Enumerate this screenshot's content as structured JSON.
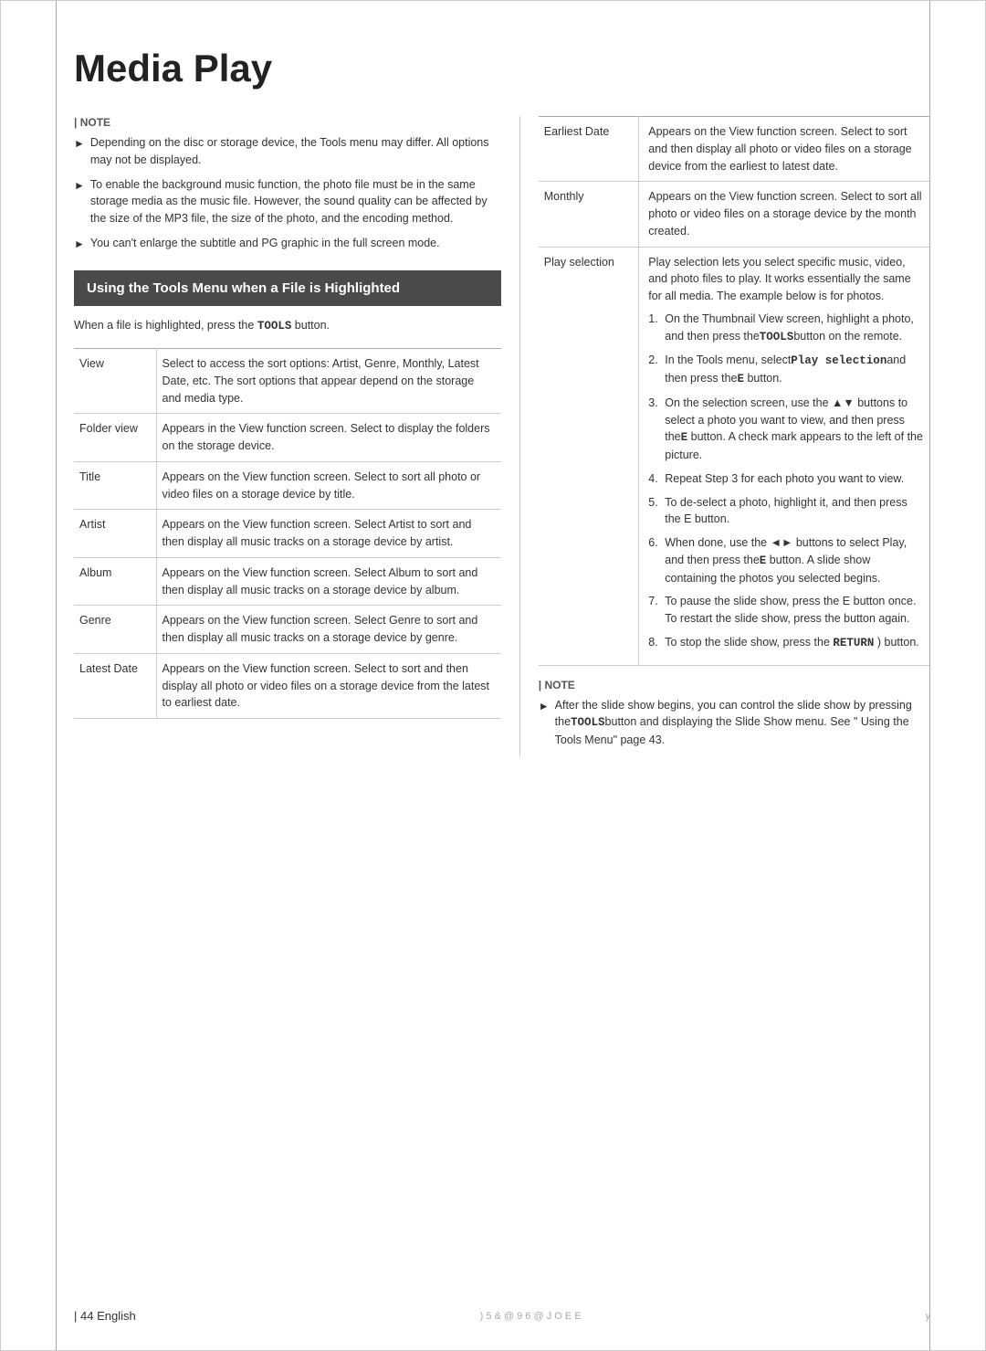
{
  "page": {
    "title": "Media Play",
    "footer": {
      "page_number": "44 English",
      "code": ") 5 &   @ 9 6 @   J O E E",
      "side_char": "y"
    }
  },
  "note_left": {
    "label": "| NOTE",
    "items": [
      "Depending on the disc or storage device, the Tools menu may differ. All options may not be displayed.",
      "To enable the background music function, the photo file must be in the same storage media as the music file. However, the sound quality can be affected by the size of the MP3 file, the size of the photo, and the encoding method.",
      "You can't enlarge the subtitle and PG graphic in the full screen mode."
    ]
  },
  "section_header": {
    "title": "Using the Tools Menu when a File is Highlighted"
  },
  "intro": {
    "text_before": "When a file is highlighted, press the ",
    "keyword": "TOOLS",
    "text_after": " button."
  },
  "menu_table": {
    "rows": [
      {
        "label": "View",
        "description": "Select to access the sort options: Artist, Genre, Monthly, Latest Date, etc. The sort options that appear depend on the storage and media type."
      },
      {
        "label": "Folder view",
        "description": "Appears in the View function screen. Select to display the folders on the storage device."
      },
      {
        "label": "Title",
        "description": "Appears on the View function screen. Select to sort all photo or video files on a storage device by title."
      },
      {
        "label": "Artist",
        "description": "Appears on the View function screen. Select Artist to sort and then display all music tracks on a storage device by artist."
      },
      {
        "label": "Album",
        "description": "Appears on the View function screen. Select Album to sort and then display all music tracks on a storage device by album."
      },
      {
        "label": "Genre",
        "description": "Appears on the View function screen. Select Genre to sort and then display all music tracks on a storage device by genre."
      },
      {
        "label": "Latest Date",
        "description": "Appears on the View function screen. Select to sort and then display all photo or video files on a storage device from the latest to earliest date."
      }
    ]
  },
  "right_col": {
    "note_label": "",
    "earliest_date_label": "Earliest Date",
    "earliest_date_desc": "Appears on the View function screen. Select to sort and then display all photo or video files on a storage device from the earliest to latest date.",
    "monthly_label": "Monthly",
    "monthly_desc": "Appears on the View function screen. Select to sort all photo or video files on a storage device by the month created.",
    "play_selection_label": "Play selection",
    "play_selection_intro": "Play selection lets you select specific music, video, and photo files to play. It works essentially the same for all media. The example below is for photos.",
    "steps": [
      {
        "num": "1.",
        "text": "On the Thumbnail View screen, highlight a photo, and then press theTOOLSbutton on the remote."
      },
      {
        "num": "2.",
        "text": "In the Tools menu, selectPlay selectionand then press theE button."
      },
      {
        "num": "3.",
        "text": "On the selection screen, use the ▲▼ buttons to select a photo you want to view, and then press theE    button. A check mark appears to the left of the picture."
      },
      {
        "num": "4.",
        "text": "Repeat Step 3 for each photo you want to view."
      },
      {
        "num": "5.",
        "text": "To de-select a photo, highlight it, and then press the E button."
      },
      {
        "num": "6.",
        "text": "When done, use the ◄► buttons to select Play, and then press theE    button. A slide show containing the photos you selected begins."
      },
      {
        "num": "7.",
        "text": "To pause the slide show, press the E   button once. To restart the slide show, pressthe button again."
      },
      {
        "num": "8.",
        "text": "To stop the slide show, press the RETURN ) button."
      }
    ],
    "note_bottom_label": "| NOTE",
    "note_bottom_items": [
      "After the slide show begins, you can control the slide show by pressing theTOOLSbutton and displaying the Slide Show menu. See \" Using the Tools Menu\" page 43."
    ]
  }
}
